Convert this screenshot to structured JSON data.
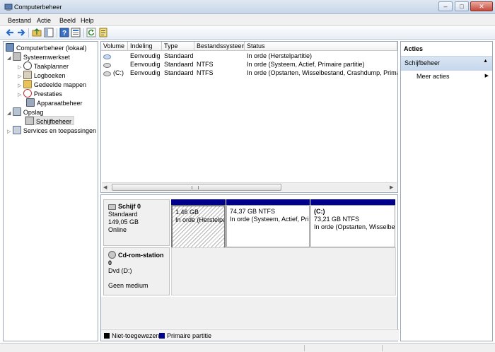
{
  "window": {
    "title": "Computerbeheer",
    "minimize": "–",
    "maximize": "□",
    "close": "✕"
  },
  "menu": [
    "Bestand",
    "Actie",
    "Beeld",
    "Help"
  ],
  "tree": {
    "root": "Computerbeheer (lokaal)",
    "items": [
      {
        "label": "Systeemwerkset"
      },
      {
        "label": "Taakplanner"
      },
      {
        "label": "Logboeken"
      },
      {
        "label": "Gedeelde mappen"
      },
      {
        "label": "Prestaties"
      },
      {
        "label": "Apparaatbeheer"
      },
      {
        "label": "Opslag"
      },
      {
        "label": "Schijfbeheer"
      },
      {
        "label": "Services en toepassingen"
      }
    ]
  },
  "volumes": {
    "headers": [
      "Volume",
      "Indeling",
      "Type",
      "Bestandssysteem",
      "Status"
    ],
    "rows": [
      {
        "volume": "",
        "indeling": "Eenvoudig",
        "type": "Standaard",
        "fs": "",
        "status": "In orde (Herstelpartitie)"
      },
      {
        "volume": "",
        "indeling": "Eenvoudig",
        "type": "Standaard",
        "fs": "NTFS",
        "status": "In orde (Systeem, Actief, Primaire partitie)"
      },
      {
        "volume": "(C:)",
        "indeling": "Eenvoudig",
        "type": "Standaard",
        "fs": "NTFS",
        "status": "In orde (Opstarten, Wisselbestand, Crashdump, Primaire p"
      }
    ]
  },
  "disks": [
    {
      "name": "Schijf 0",
      "type": "Standaard",
      "size": "149,05 GB",
      "state": "Online",
      "partitions": [
        {
          "label": "",
          "size": "1,46 GB",
          "status": "In orde (Herstelpa"
        },
        {
          "label": "",
          "size": "74,37 GB NTFS",
          "status": "In orde (Systeem, Actief, Prim"
        },
        {
          "label": "(C:)",
          "size": "73,21 GB NTFS",
          "status": "In orde (Opstarten, Wisselbest"
        }
      ]
    },
    {
      "name": "Cd-rom-station 0",
      "type": "Dvd (D:)",
      "media": "Geen medium"
    }
  ],
  "legend": [
    {
      "label": "Niet-toegewezen",
      "color": "#000000"
    },
    {
      "label": "Primaire partitie",
      "color": "#00008b"
    }
  ],
  "actions": {
    "title": "Acties",
    "section": "Schijfbeheer",
    "more": "Meer acties"
  }
}
